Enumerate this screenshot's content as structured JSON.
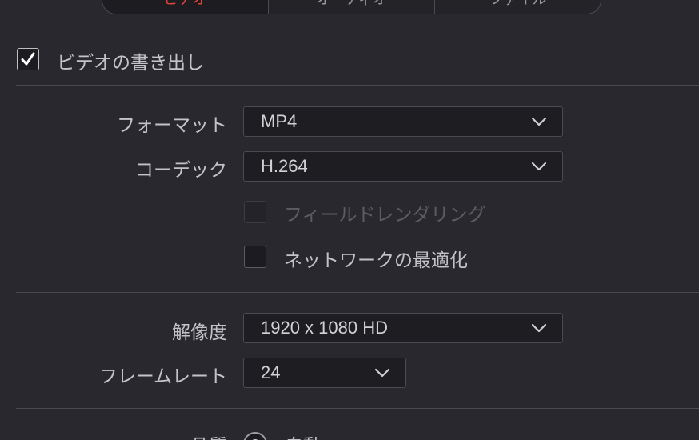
{
  "tabs": [
    {
      "label": "ビデオ",
      "active": true
    },
    {
      "label": "オーディオ",
      "active": false
    },
    {
      "label": "ファイル",
      "active": false
    }
  ],
  "export_video": {
    "label": "ビデオの書き出し",
    "checked": true
  },
  "format": {
    "label": "フォーマット",
    "value": "MP4"
  },
  "codec": {
    "label": "コーデック",
    "value": "H.264"
  },
  "field_rendering": {
    "label": "フィールドレンダリング",
    "checked": false,
    "enabled": false
  },
  "network_optimize": {
    "label": "ネットワークの最適化",
    "checked": false,
    "enabled": true
  },
  "resolution": {
    "label": "解像度",
    "value": "1920 x 1080 HD"
  },
  "frame_rate": {
    "label": "フレームレート",
    "value": "24"
  },
  "quality": {
    "label": "品質",
    "option_auto": "自動"
  },
  "colors": {
    "background": "#28282e",
    "active_tab_text": "#e0443a",
    "field_bg": "#1e1e22",
    "border": "#4a4a50"
  }
}
